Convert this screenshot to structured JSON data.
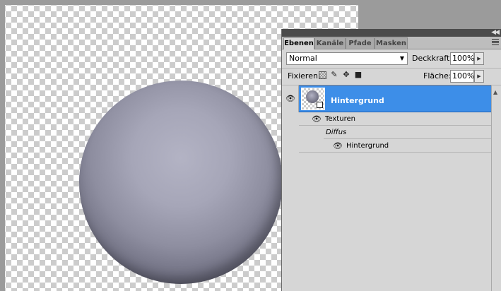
{
  "layers_panel": {
    "tabs": [
      "Ebenen",
      "Kanäle",
      "Pfade",
      "Masken"
    ],
    "active_tab": "Ebenen",
    "blend_mode": "Normal",
    "opacity_label": "Deckkraft:",
    "opacity_value": "100%",
    "lock_label": "Fixieren:",
    "fill_label": "Fläche:",
    "fill_value": "100%",
    "layers": [
      {
        "name": "Hintergrund",
        "selected": true,
        "visible": true,
        "sub_items": [
          {
            "label": "Texturen",
            "visible": true
          },
          {
            "label": "Diffus",
            "italic": true
          },
          {
            "label": "Hintergrund",
            "visible": true
          }
        ]
      }
    ]
  },
  "icons": {
    "eye": "eye-icon",
    "panel_menu": "panel-menu-icon",
    "collapse": "collapse-panel-icon",
    "lock_transparency": "lock-transparent-pixels-icon",
    "lock_image": "lock-image-pixels-icon",
    "lock_position": "lock-position-icon",
    "lock_all": "lock-all-icon"
  },
  "colors": {
    "selection": "#3d8ee8",
    "panel_bg": "#d6d6d6",
    "workspace_bg": "#9b9b9b"
  }
}
